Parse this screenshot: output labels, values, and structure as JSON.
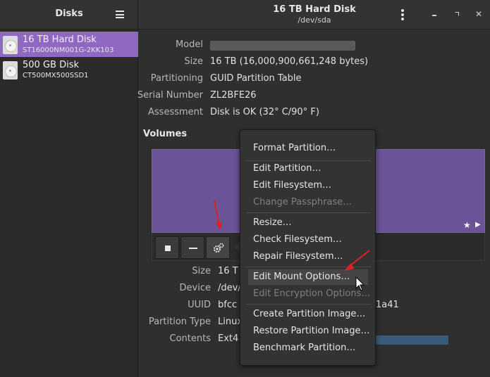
{
  "sidebar": {
    "title": "Disks",
    "disks": [
      {
        "name": "16 TB Hard Disk",
        "model": "ST16000NM001G-2KK103",
        "selected": true
      },
      {
        "name": "500 GB Disk",
        "model": "CT500MX500SSD1",
        "selected": false
      }
    ]
  },
  "header": {
    "title": "16 TB Hard Disk",
    "subtitle": "/dev/sda"
  },
  "info": {
    "model_label": "Model",
    "size_label": "Size",
    "size_value": "16 TB (16,000,900,661,248 bytes)",
    "partitioning_label": "Partitioning",
    "partitioning_value": "GUID Partition Table",
    "serial_label": "Serial Number",
    "serial_value": "ZL2BFE26",
    "assessment_label": "Assessment",
    "assessment_value": "Disk is OK (32° C/90° F)"
  },
  "volumes": {
    "title": "Volumes",
    "details": {
      "size_label": "Size",
      "size_value": "16 T",
      "device_label": "Device",
      "device_value": "/dev/",
      "uuid_label": "UUID",
      "uuid_value_start": "bfcc",
      "uuid_value_end": "1a41",
      "ptype_label": "Partition Type",
      "ptype_value": "Linux",
      "contents_label": "Contents",
      "contents_value": "Ext4"
    }
  },
  "menu": {
    "groups": [
      [
        {
          "label": "Format Partition…",
          "disabled": false
        }
      ],
      [
        {
          "label": "Edit Partition…",
          "disabled": false
        },
        {
          "label": "Edit Filesystem…",
          "disabled": false
        },
        {
          "label": "Change Passphrase…",
          "disabled": true
        }
      ],
      [
        {
          "label": "Resize…",
          "disabled": false
        },
        {
          "label": "Check Filesystem…",
          "disabled": false
        },
        {
          "label": "Repair Filesystem…",
          "disabled": false
        }
      ],
      [
        {
          "label": "Edit Mount Options…",
          "disabled": false,
          "hover": true
        },
        {
          "label": "Edit Encryption Options…",
          "disabled": true
        }
      ],
      [
        {
          "label": "Create Partition Image…",
          "disabled": false
        },
        {
          "label": "Restore Partition Image…",
          "disabled": false
        },
        {
          "label": "Benchmark Partition…",
          "disabled": false
        }
      ]
    ]
  },
  "colors": {
    "accent": "#8f68c2",
    "volume": "#6a5396",
    "annotation_arrow": "#e02020"
  }
}
